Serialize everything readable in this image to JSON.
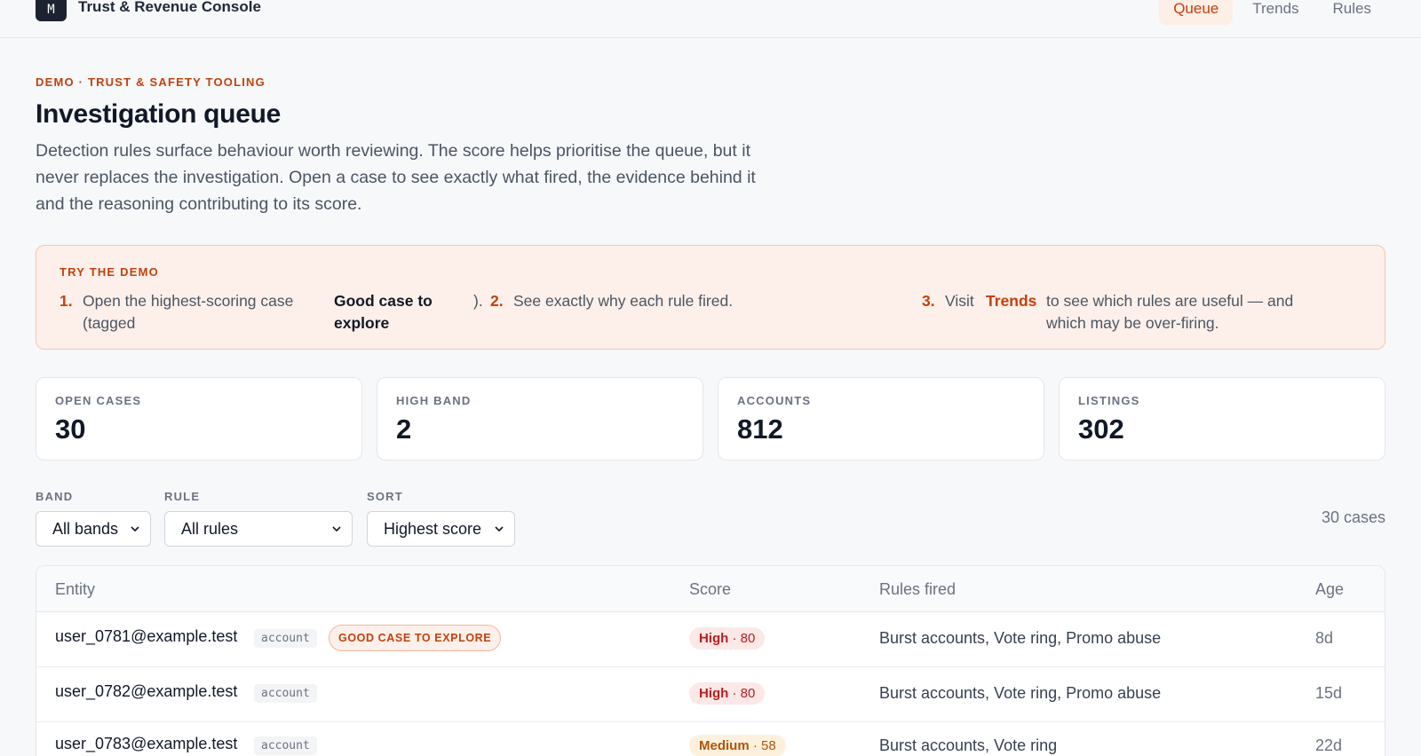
{
  "app": {
    "logo_letter": "M",
    "title": "Trust & Revenue Console",
    "nav": [
      {
        "label": "Queue",
        "active": true
      },
      {
        "label": "Trends",
        "active": false
      },
      {
        "label": "Rules",
        "active": false
      }
    ]
  },
  "header": {
    "eyebrow": "DEMO · TRUST & SAFETY TOOLING",
    "title": "Investigation queue",
    "intro": "Detection rules surface behaviour worth reviewing. The score helps prioritise the queue, but it never replaces the investigation. Open a case to see exactly what fired, the evidence behind it and the reasoning contributing to its score."
  },
  "demo": {
    "title": "TRY THE DEMO",
    "step1_num": "1.",
    "step1_text": "Open the highest-scoring case (tagged",
    "step1_tag": "Good case to explore",
    "step1_end": ").",
    "step2_num": "2.",
    "step2_text": "See exactly why each rule fired.",
    "step3_num": "3.",
    "step3_pre": "Visit",
    "step3_link": "Trends",
    "step3_post": "to see which rules are useful — and which may be over-firing."
  },
  "stats": [
    {
      "label": "OPEN CASES",
      "value": "30"
    },
    {
      "label": "HIGH BAND",
      "value": "2"
    },
    {
      "label": "ACCOUNTS",
      "value": "812"
    },
    {
      "label": "LISTINGS",
      "value": "302"
    }
  ],
  "filters": {
    "band_label": "BAND",
    "band_value": "All bands",
    "rule_label": "RULE",
    "rule_value": "All rules",
    "sort_label": "SORT",
    "sort_value": "Highest score",
    "count": "30 cases"
  },
  "table": {
    "headers": {
      "entity": "Entity",
      "score": "Score",
      "rules": "Rules fired",
      "age": "Age"
    },
    "rows": [
      {
        "entity": "user_0781@example.test",
        "type": "account",
        "tag": "GOOD CASE TO EXPLORE",
        "band": "High",
        "score": "· 80",
        "rules": "Burst accounts, Vote ring, Promo abuse",
        "age": "8d"
      },
      {
        "entity": "user_0782@example.test",
        "type": "account",
        "tag": "",
        "band": "High",
        "score": "· 80",
        "rules": "Burst accounts, Vote ring, Promo abuse",
        "age": "15d"
      },
      {
        "entity": "user_0783@example.test",
        "type": "account",
        "tag": "",
        "band": "Medium",
        "score": "· 58",
        "rules": "Burst accounts, Vote ring",
        "age": "22d"
      }
    ]
  },
  "colors": {
    "accent": "#c2410c",
    "high_bg": "#fde8e8",
    "high_fg": "#b91c1c",
    "medium_bg": "#fdf1dd",
    "medium_fg": "#b45309"
  }
}
